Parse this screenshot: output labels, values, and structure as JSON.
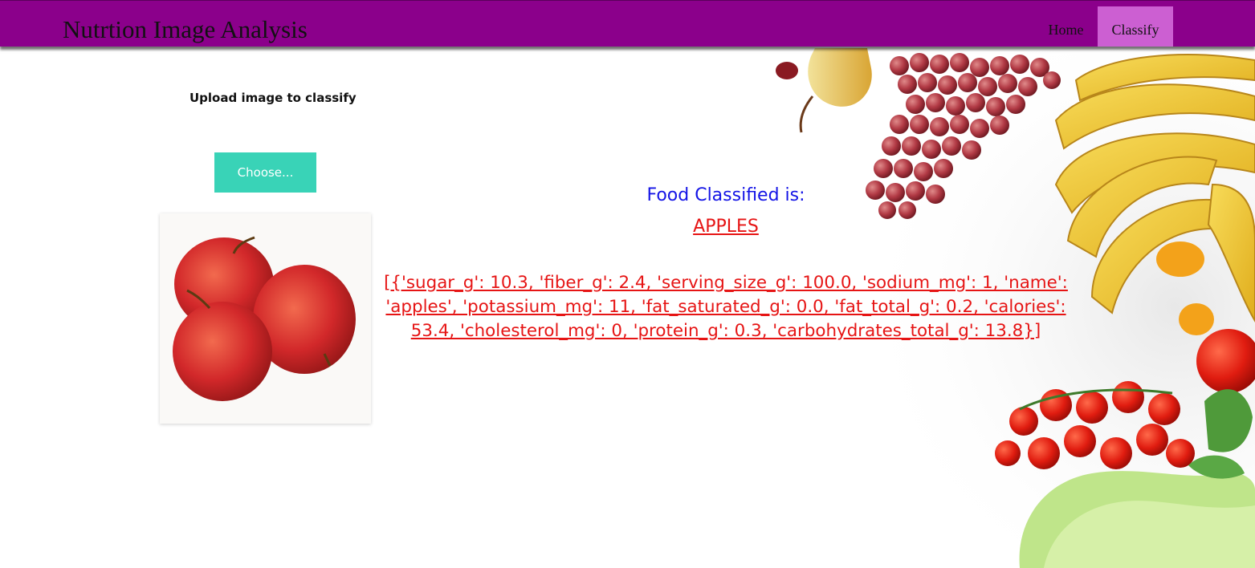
{
  "navbar": {
    "brand": "Nutrtion Image Analysis",
    "links": [
      {
        "label": "Home",
        "active": false
      },
      {
        "label": "Classify",
        "active": true
      }
    ],
    "background_color": "#8b008b",
    "active_link_color": "#cc5fd2"
  },
  "upload": {
    "label": "Upload image to classify",
    "choose_button_label": "Choose...",
    "button_color": "#39d3b7",
    "preview_icon": "red-apples-photo"
  },
  "result": {
    "heading": "Food Classified is:",
    "food_name": "APPLES",
    "nutrition_text": "[{'sugar_g': 10.3, 'fiber_g': 2.4, 'serving_size_g': 100.0, 'sodium_mg': 1, 'name': 'apples', 'potassium_mg': 11, 'fat_saturated_g': 0.0, 'fat_total_g': 0.2, 'calories': 53.4, 'cholesterol_mg': 0, 'protein_g': 0.3, 'carbohydrates_total_g': 13.8}]",
    "heading_color": "#1414e6",
    "value_color": "#e61414"
  },
  "background": {
    "icons": [
      "grapes-icon",
      "pear-icon",
      "bananas-icon",
      "cherry-tomatoes-icon",
      "lettuce-icon"
    ]
  }
}
